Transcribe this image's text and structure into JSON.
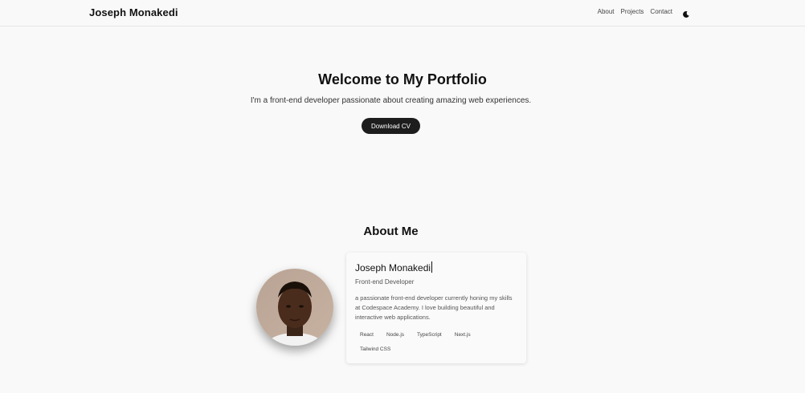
{
  "nav": {
    "brand": "Joseph Monakedi",
    "links": [
      "About",
      "Projects",
      "Contact"
    ],
    "theme_toggle_icon": "moon-icon"
  },
  "hero": {
    "title": "Welcome to My Portfolio",
    "subtitle": "I'm a front-end developer passionate about creating amazing web experiences.",
    "cta_label": "Download CV"
  },
  "about": {
    "title": "About Me",
    "avatar_icon": "profile-photo",
    "card": {
      "name": "Joseph Monakedi",
      "role": "Front-end Developer",
      "bio": "a passionate front-end developer currently honing my skills at Codespace Academy. I love building beautiful and interactive web applications.",
      "skills": [
        "React",
        "Node.js",
        "TypeScript",
        "Next.js",
        "Tailwind CSS"
      ]
    }
  },
  "colors": {
    "background": "#f9f9f9",
    "button": "#1d1d1d",
    "text": "#111111"
  }
}
